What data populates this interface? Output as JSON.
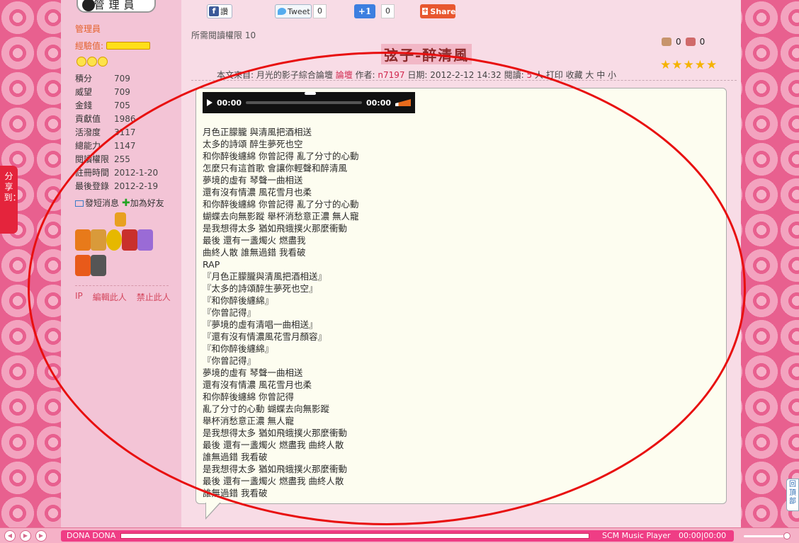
{
  "sidebar": {
    "role_badge": "管理員",
    "group": "管理員",
    "exp_label": "經驗值:",
    "stats": [
      {
        "label": "積分",
        "value": "709"
      },
      {
        "label": "威望",
        "value": "709"
      },
      {
        "label": "金錢",
        "value": "705"
      },
      {
        "label": "貢獻值",
        "value": "1986"
      },
      {
        "label": "活潑度",
        "value": "3117"
      },
      {
        "label": "總能力",
        "value": "1147"
      },
      {
        "label": "閱讀權限",
        "value": "255"
      },
      {
        "label": "註冊時間",
        "value": "2012-1-20"
      },
      {
        "label": "最後登錄",
        "value": "2012-2-19"
      }
    ],
    "send_message": "發短消息",
    "add_friend": "加為好友",
    "admin_links": [
      "IP",
      "編輯此人",
      "禁止此人"
    ]
  },
  "share_bar": {
    "fb_label": "讚",
    "tweet_label": "Tweet",
    "tweet_count": "0",
    "plusone_label": "+1",
    "plusone_count": "0",
    "share_label": "Share"
  },
  "post": {
    "read_permission": "所需閱讀權限 10",
    "title": "弦子-醉清風",
    "like_count": "0",
    "dislike_count": "0",
    "meta": {
      "source_prefix": "本文來自: 月光的影子綜合論壇",
      "forum_link": "論壇",
      "author_label": "作者:",
      "author": "n7197",
      "date": "日期: 2012-2-12 14:32",
      "views_label": "閱讀:",
      "views": "5",
      "views_suffix": "人",
      "tools": "打印 收藏 大 中 小"
    },
    "player": {
      "current": "00:00",
      "total": "00:00"
    },
    "lyrics": [
      "月色正朦朧 與清風把酒相送",
      "太多的詩頌 醉生夢死也空",
      "和你醉後纏綿 你曾記得 亂了分寸的心動",
      "怎麼只有這首歌 會讓你輕聲和醉清風",
      "夢境的虛有 琴聲一曲相送",
      "還有沒有情濃 風花雪月也柔",
      "和你醉後纏綿 你曾記得 亂了分寸的心動",
      "蝴蝶去向無影蹤 舉杯消愁意正濃 無人寵",
      "是我想得太多 猶如飛蛾撲火那麼衝動",
      "最後 還有一盞燭火 燃盡我",
      "曲終人散 誰無過錯 我看破",
      "RAP",
      "『月色正朦朧與清風把酒相送』",
      "『太多的詩頌醉生夢死也空』",
      "『和你醉後纏綿』",
      "『你曾記得』",
      "『夢境的虛有清唱一曲相送』",
      "『還有沒有情濃風花雪月顏容』",
      "『和你醉後纏綿』",
      "『你曾記得』",
      "夢境的虛有 琴聲一曲相送",
      "還有沒有情濃 風花雪月也柔",
      "和你醉後纏綿 你曾記得",
      "亂了分寸的心動 蝴蝶去向無影蹤",
      "舉杯消愁意正濃 無人寵",
      "是我想得太多 猶如飛蛾撲火那麼衝動",
      "最後 還有一盞燭火 燃盡我 曲終人散",
      "誰無過錯 我看破",
      "是我想得太多 猶如飛蛾撲火那麼衝動",
      "最後 還有一盞燭火 燃盡我 曲終人散",
      "誰無過錯 我看破"
    ]
  },
  "side_share": "分享到：",
  "back_top": "回頂部",
  "music_player": {
    "song": "DONA DONA",
    "name": "SCM Music Player",
    "time": "00:00|00:00"
  },
  "colors": {
    "accent": "#e4243c",
    "background": "#e8608f",
    "annotation": "#e80f0f"
  }
}
